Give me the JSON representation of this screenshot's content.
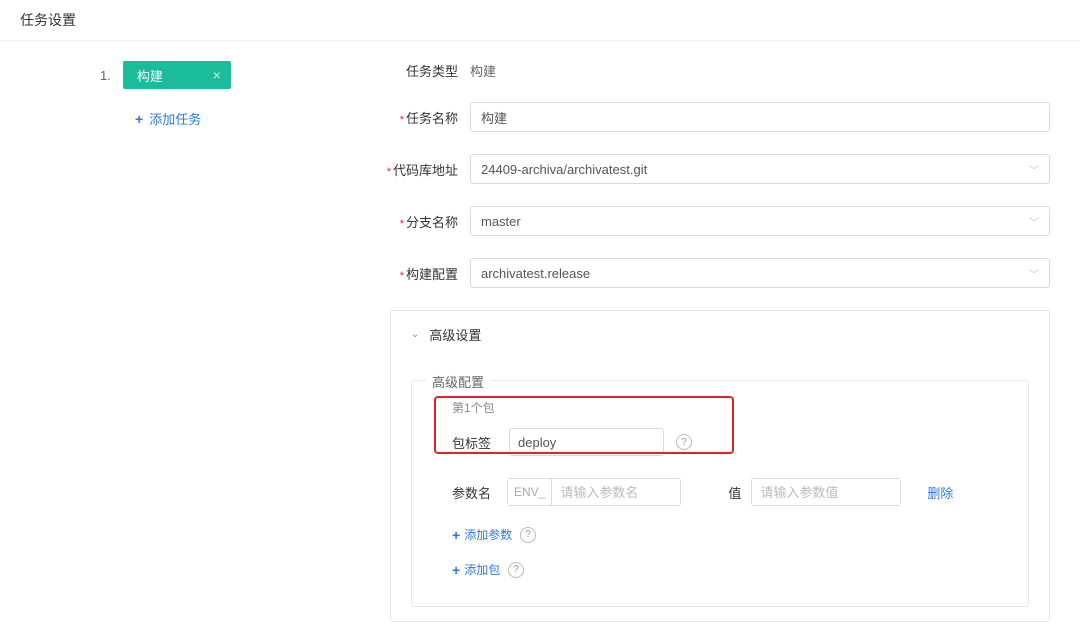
{
  "page_title": "任务设置",
  "sidebar": {
    "steps": [
      {
        "num": "1.",
        "label": "构建"
      }
    ],
    "add_task": "添加任务"
  },
  "form": {
    "task_type_label": "任务类型",
    "task_type_value": "构建",
    "task_name_label": "任务名称",
    "task_name_value": "构建",
    "repo_label": "代码库地址",
    "repo_value": "24409-archiva/archivatest.git",
    "branch_label": "分支名称",
    "branch_value": "master",
    "build_cfg_label": "构建配置",
    "build_cfg_value": "archivatest.release"
  },
  "advanced": {
    "section_title": "高级设置",
    "box_title": "高级配置",
    "pkg_index": "第1个包",
    "tag_label": "包标签",
    "tag_value": "deploy",
    "param_label": "参数名",
    "param_prefix": "ENV_",
    "param_placeholder": "请输入参数名",
    "value_label": "值",
    "value_placeholder": "请输入参数值",
    "delete_label": "删除",
    "add_param": "添加参数",
    "add_pkg": "添加包"
  }
}
